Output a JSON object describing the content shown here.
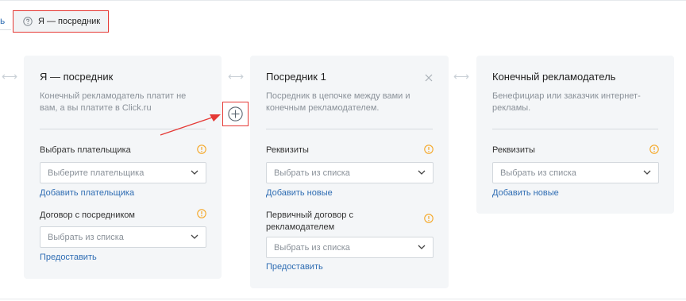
{
  "tabs": {
    "left_stub": "ь",
    "active_label": "Я — посредник"
  },
  "cards": {
    "me": {
      "title": "Я — посредник",
      "description": "Конечный рекламодатель платит не вам, а вы платите в Click.ru",
      "payer_label": "Выбрать плательщика",
      "payer_placeholder": "Выберите плательщика",
      "payer_link": "Добавить плательщика",
      "contract_label": "Договор с посредником",
      "contract_placeholder": "Выбрать из списка",
      "contract_link": "Предоставить"
    },
    "intermediary": {
      "title": "Посредник 1",
      "description": "Посредник в цепочке между вами и конечным рекламодателем.",
      "details_label": "Реквизиты",
      "details_placeholder": "Выбрать из списка",
      "details_link": "Добавить новые",
      "contract_label": "Первичный договор с рекламодателем",
      "contract_placeholder": "Выбрать из списка",
      "contract_link": "Предоставить"
    },
    "advertiser": {
      "title": "Конечный рекламодатель",
      "description": "Бенефициар или заказчик интернет-рекламы.",
      "details_label": "Реквизиты",
      "details_placeholder": "Выбрать из списка",
      "details_link": "Добавить новые"
    }
  },
  "colors": {
    "accent_link": "#2f6db3",
    "warning": "#f5a623",
    "highlight": "#e53935",
    "card_bg": "#f4f6f8"
  },
  "icons": {
    "tab": "help-circle-icon",
    "warning": "warning-circle-icon",
    "close": "close-icon",
    "add": "plus-circle-icon",
    "chevron": "chevron-down-icon",
    "link_arrows": "double-arrow-icon"
  }
}
